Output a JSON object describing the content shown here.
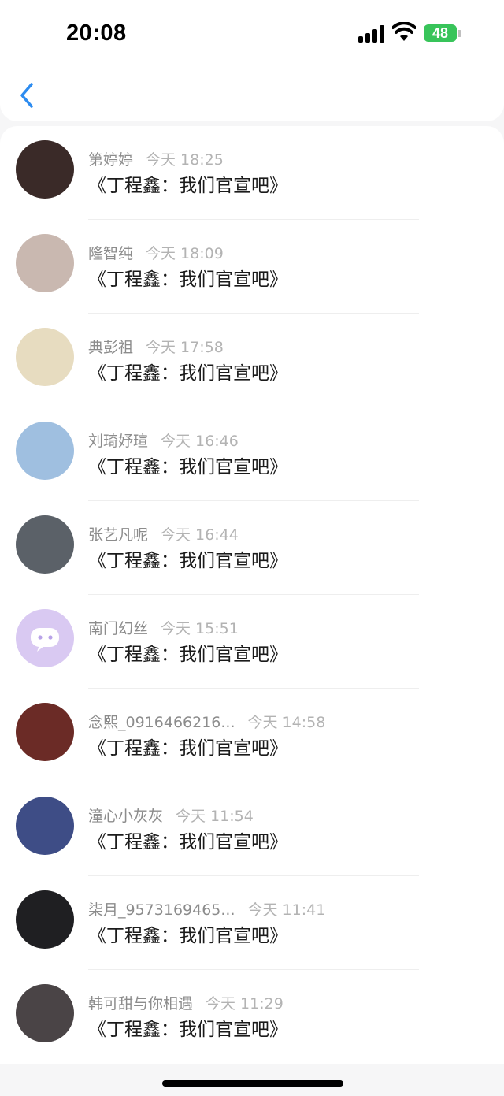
{
  "status_bar": {
    "time": "20:08",
    "battery": "48"
  },
  "nav": {
    "back_icon": "chevron-left-icon"
  },
  "items": [
    {
      "name": "第婷婷",
      "time": "今天 18:25",
      "message": "《丁程鑫：我们官宣吧》",
      "avatar_color": "#3a2a28"
    },
    {
      "name": "隆智纯",
      "time": "今天 18:09",
      "message": "《丁程鑫：我们官宣吧》",
      "avatar_color": "#c9b8b0"
    },
    {
      "name": "典彭祖",
      "time": "今天 17:58",
      "message": "《丁程鑫：我们官宣吧》",
      "avatar_color": "#e7dcc0"
    },
    {
      "name": "刘琦妤瑄",
      "time": "今天 16:46",
      "message": "《丁程鑫：我们官宣吧》",
      "avatar_color": "#9fbfe0"
    },
    {
      "name": "张艺凡呢",
      "time": "今天 16:44",
      "message": "《丁程鑫：我们官宣吧》",
      "avatar_color": "#5b6168"
    },
    {
      "name": "南门幻丝",
      "time": "今天 15:51",
      "message": "《丁程鑫：我们官宣吧》",
      "avatar_color": "#d9c9f2"
    },
    {
      "name": "念熙_0916466216...",
      "time": "今天 14:58",
      "message": "《丁程鑫：我们官宣吧》",
      "avatar_color": "#6b2b26"
    },
    {
      "name": "潼心小灰灰",
      "time": "今天 11:54",
      "message": "《丁程鑫：我们官宣吧》",
      "avatar_color": "#3e4d86"
    },
    {
      "name": "柒月_9573169465...",
      "time": "今天 11:41",
      "message": "《丁程鑫：我们官宣吧》",
      "avatar_color": "#1f1f22"
    },
    {
      "name": "韩可甜与你相遇",
      "time": "今天 11:29",
      "message": "《丁程鑫：我们官宣吧》",
      "avatar_color": "#4a4446"
    }
  ]
}
